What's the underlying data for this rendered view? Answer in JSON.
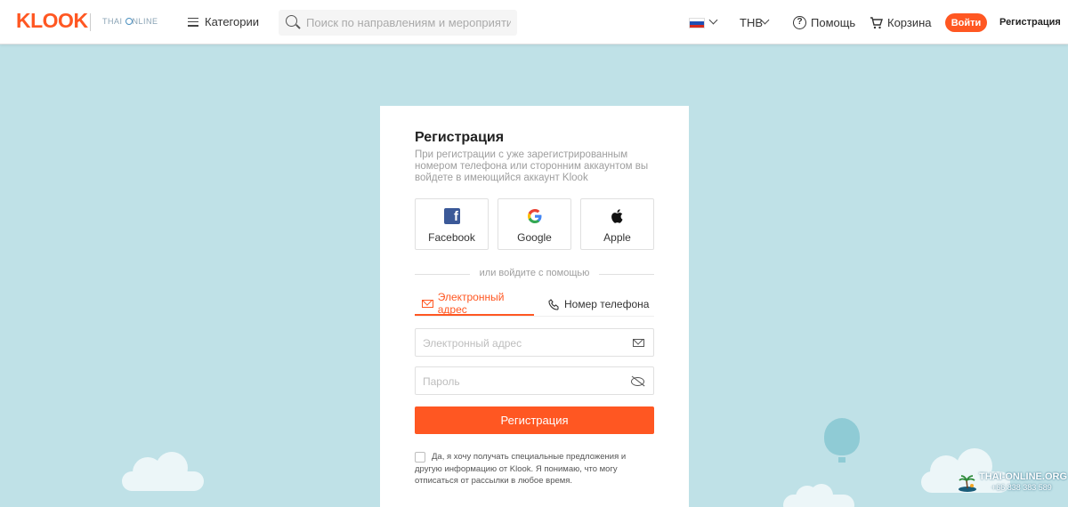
{
  "header": {
    "logo": "KLOOK",
    "partner": "THAI ONLINE",
    "categories_label": "Категории",
    "search_placeholder": "Поиск по направлениям и мероприятиям",
    "currency": "THB",
    "help_label": "Помощь",
    "cart_label": "Корзина",
    "login_label": "Войти",
    "register_label": "Регистрация"
  },
  "card": {
    "title": "Регистрация",
    "subtitle": "При регистрации с уже зарегистрированным номером телефона или сторонним аккаунтом вы войдете в имеющийся аккаунт Klook",
    "social": [
      {
        "label": "Facebook",
        "icon": "facebook-icon"
      },
      {
        "label": "Google",
        "icon": "google-icon"
      },
      {
        "label": "Apple",
        "icon": "apple-icon"
      }
    ],
    "divider_text": "или войдите с помощью",
    "tabs": {
      "email": "Электронный адрес",
      "phone": "Номер телефона"
    },
    "email_placeholder": "Электронный адрес",
    "password_placeholder": "Пароль",
    "submit_label": "Регистрация",
    "consent_text": "Да, я хочу получать специальные предложения и другую информацию от Klook. Я понимаю, что могу отписаться от рассылки в любое время."
  },
  "watermark": {
    "site": "THAI-ONLINE.ORG",
    "phone": "+66 838 383 589"
  },
  "colors": {
    "accent": "#ff5722",
    "background": "#bfe1e7"
  }
}
